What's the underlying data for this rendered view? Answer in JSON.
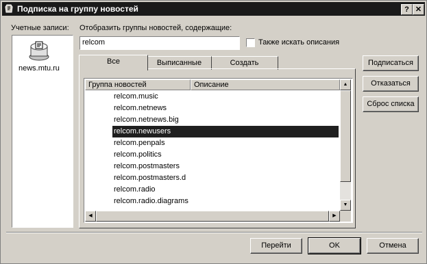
{
  "window": {
    "title": "Подписка на группу новостей",
    "help_btn": "?",
    "close_btn": "✕"
  },
  "accounts": {
    "label": "Учетные записи:",
    "items": [
      "news.mtu.ru"
    ]
  },
  "filter": {
    "label": "Отобразить группы новостей, содержащие:",
    "value": "relcom",
    "also_desc_label": "Также искать описания",
    "also_desc_checked": false
  },
  "tabs": [
    "Все",
    "Выписанные",
    "Создать"
  ],
  "active_tab": "Все",
  "list": {
    "columns": [
      "Группа новостей",
      "Описание"
    ],
    "rows": [
      "relcom.music",
      "relcom.netnews",
      "relcom.netnews.big",
      "relcom.newusers",
      "relcom.penpals",
      "relcom.politics",
      "relcom.postmasters",
      "relcom.postmasters.d",
      "relcom.radio",
      "relcom.radio.diagrams"
    ],
    "selected": "relcom.newusers"
  },
  "side_buttons": {
    "subscribe": "Подписаться",
    "unsubscribe": "Отказаться",
    "reset": "Сброс списка"
  },
  "footer": {
    "goto": "Перейти",
    "ok": "OK",
    "cancel": "Отмена"
  }
}
